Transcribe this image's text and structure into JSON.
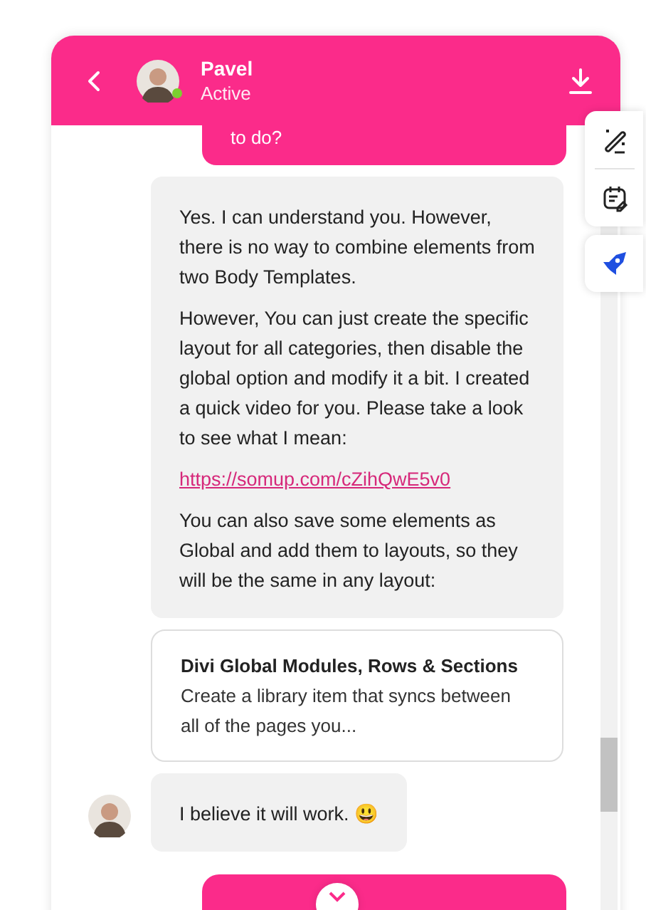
{
  "header": {
    "name": "Pavel",
    "status": "Active",
    "online": true
  },
  "messages": [
    {
      "kind": "outgoing",
      "text": "to do?"
    },
    {
      "kind": "incoming",
      "show_avatar": false,
      "blocks": [
        {
          "kind": "text",
          "text": "Yes. I can understand you. However, there is no way to combine elements from two Body Templates."
        },
        {
          "kind": "text",
          "text": "However, You can just create the specific layout for all categories, then disable the global option and modify it a bit. I created a quick video for you. Please take a look to see what I mean:"
        },
        {
          "kind": "link",
          "text": "https://somup.com/cZihQwE5v0"
        },
        {
          "kind": "text",
          "text": "You can also save some elements as Global and add them to layouts, so they will be the same in any layout:"
        }
      ]
    },
    {
      "kind": "card",
      "title": "Divi Global Modules, Rows & Sections",
      "description": "Create a library item that syncs between all of the pages you..."
    },
    {
      "kind": "incoming",
      "show_avatar": true,
      "blocks": [
        {
          "kind": "text",
          "text": "I believe it will work. 😃"
        }
      ]
    },
    {
      "kind": "outgoing"
    }
  ]
}
